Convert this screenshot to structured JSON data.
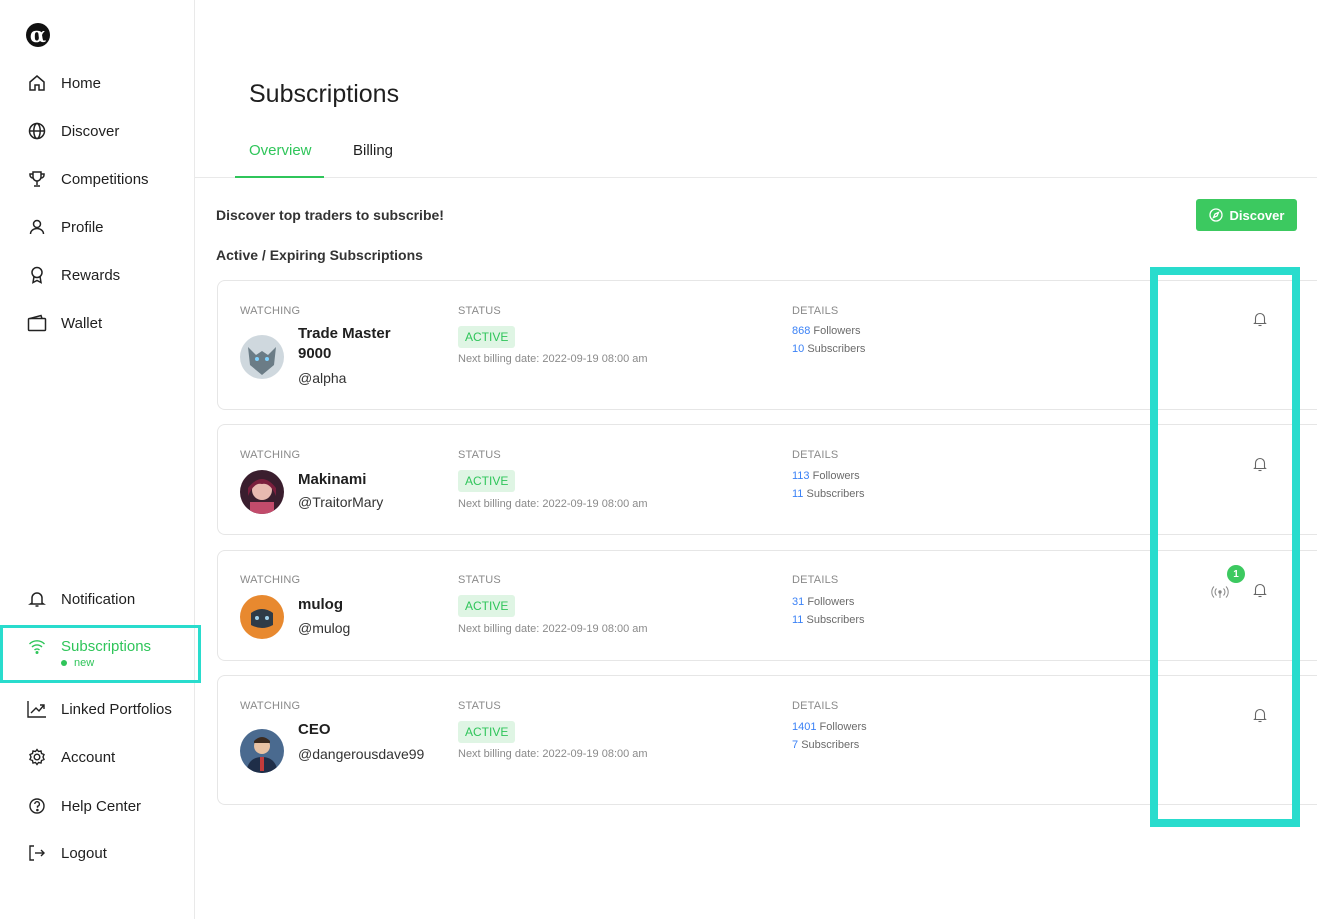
{
  "sidebar": {
    "logo": "α",
    "items": [
      {
        "label": "Home",
        "icon": "home-icon"
      },
      {
        "label": "Discover",
        "icon": "globe-icon"
      },
      {
        "label": "Competitions",
        "icon": "trophy-icon"
      },
      {
        "label": "Profile",
        "icon": "user-icon"
      },
      {
        "label": "Rewards",
        "icon": "award-icon"
      },
      {
        "label": "Wallet",
        "icon": "wallet-icon"
      }
    ],
    "bottom_items": [
      {
        "label": "Notification",
        "icon": "bell-icon"
      },
      {
        "label": "Subscriptions",
        "icon": "wifi-icon",
        "tag": "new"
      },
      {
        "label": "Linked Portfolios",
        "icon": "chart-icon"
      },
      {
        "label": "Account",
        "icon": "gear-icon"
      },
      {
        "label": "Help Center",
        "icon": "help-icon"
      },
      {
        "label": "Logout",
        "icon": "logout-icon"
      }
    ]
  },
  "main": {
    "title": "Subscriptions",
    "tabs": [
      {
        "label": "Overview"
      },
      {
        "label": "Billing"
      }
    ],
    "intro": "Discover top traders to subscribe!",
    "discover_button": "Discover",
    "section_title": "Active / Expiring Subscriptions",
    "column_headers": {
      "watching": "WATCHING",
      "status": "STATUS",
      "details": "DETAILS"
    },
    "subscriptions": [
      {
        "name": "Trade Master 9000",
        "handle": "@alpha",
        "status": "ACTIVE",
        "billing": "Next billing date: 2022-09-19 08:00 am",
        "followers": "868",
        "followers_label": "Followers",
        "subscribers": "10",
        "subscribers_label": "Subscribers",
        "notifications": null
      },
      {
        "name": "Makinami",
        "handle": "@TraitorMary",
        "status": "ACTIVE",
        "billing": "Next billing date: 2022-09-19 08:00 am",
        "followers": "113",
        "followers_label": "Followers",
        "subscribers": "11",
        "subscribers_label": "Subscribers",
        "notifications": null
      },
      {
        "name": "mulog",
        "handle": "@mulog",
        "status": "ACTIVE",
        "billing": "Next billing date: 2022-09-19 08:00 am",
        "followers": "31",
        "followers_label": "Followers",
        "subscribers": "11",
        "subscribers_label": "Subscribers",
        "notifications": "1"
      },
      {
        "name": "CEO",
        "handle": "@dangerousdave99",
        "status": "ACTIVE",
        "billing": "Next billing date: 2022-09-19 08:00 am",
        "followers": "1401",
        "followers_label": "Followers",
        "subscribers": "7",
        "subscribers_label": "Subscribers",
        "notifications": null
      }
    ]
  },
  "colors": {
    "accent": "#2fc55a",
    "highlight": "#29dccd",
    "link": "#3b82f6"
  }
}
